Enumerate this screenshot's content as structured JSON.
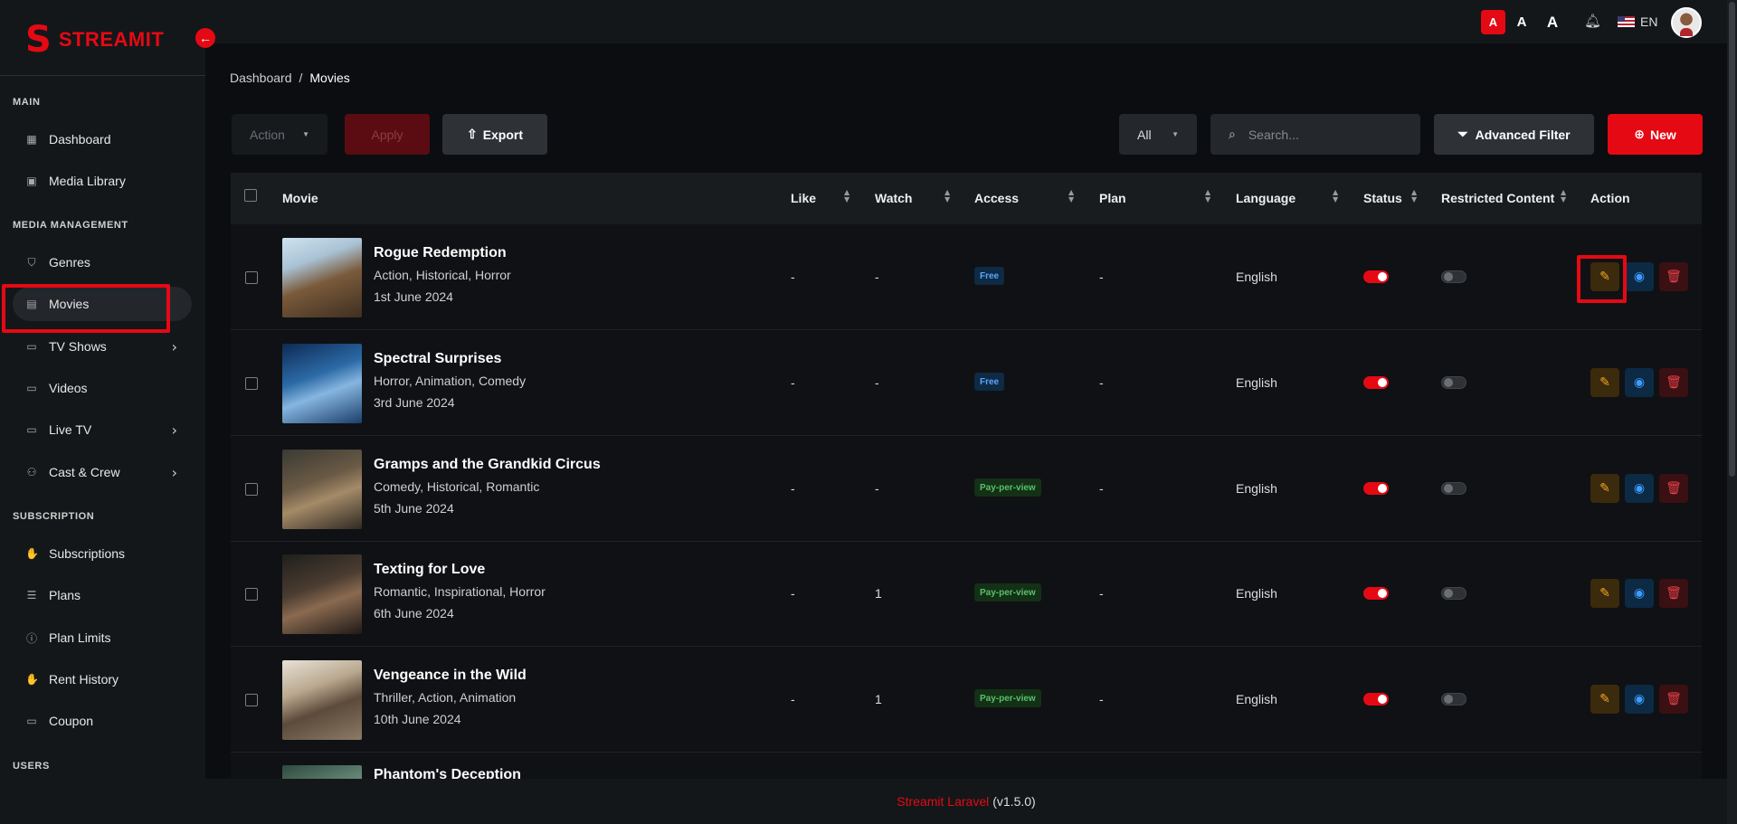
{
  "app": {
    "logo_glyph": "S",
    "logo_text": "STREAMIT",
    "accent": "#e50914"
  },
  "sidebar": {
    "sections": [
      {
        "label": "MAIN"
      },
      {
        "label": "MEDIA MANAGEMENT"
      },
      {
        "label": "SUBSCRIPTION"
      },
      {
        "label": "USERS"
      }
    ],
    "items": [
      {
        "label": "Dashboard",
        "icon": "grid-icon"
      },
      {
        "label": "Media Library",
        "icon": "image-icon"
      },
      {
        "label": "Genres",
        "icon": "shield-icon"
      },
      {
        "label": "Movies",
        "icon": "film-icon",
        "active": true
      },
      {
        "label": "TV Shows",
        "icon": "tv-icon",
        "has_children": true
      },
      {
        "label": "Videos",
        "icon": "video-icon"
      },
      {
        "label": "Live TV",
        "icon": "live-tv-icon",
        "has_children": true
      },
      {
        "label": "Cast & Crew",
        "icon": "users-icon",
        "has_children": true
      },
      {
        "label": "Subscriptions",
        "icon": "hand-icon"
      },
      {
        "label": "Plans",
        "icon": "list-icon"
      },
      {
        "label": "Plan Limits",
        "icon": "info-icon"
      },
      {
        "label": "Rent History",
        "icon": "hand-icon"
      },
      {
        "label": "Coupon",
        "icon": "ticket-icon"
      }
    ]
  },
  "topbar": {
    "font_sizes": [
      "A",
      "A",
      "A"
    ],
    "language": "EN"
  },
  "breadcrumb": {
    "root": "Dashboard",
    "separator": "/",
    "current": "Movies"
  },
  "toolbar": {
    "action_placeholder": "Action",
    "apply_label": "Apply",
    "export_label": "Export",
    "filter_value": "All",
    "search_placeholder": "Search...",
    "advanced_filter_label": "Advanced Filter",
    "new_label": "New"
  },
  "table": {
    "columns": [
      "Movie",
      "Like",
      "Watch",
      "Access",
      "Plan",
      "Language",
      "Status",
      "Restricted Content",
      "Action"
    ],
    "rows": [
      {
        "title": "Rogue Redemption",
        "genres": "Action, Historical, Horror",
        "date": "1st June 2024",
        "like": "-",
        "watch": "-",
        "access": "Free",
        "plan": "-",
        "language": "English",
        "status": true,
        "restricted": false
      },
      {
        "title": "Spectral Surprises",
        "genres": "Horror, Animation, Comedy",
        "date": "3rd June 2024",
        "like": "-",
        "watch": "-",
        "access": "Free",
        "plan": "-",
        "language": "English",
        "status": true,
        "restricted": false
      },
      {
        "title": "Gramps and the Grandkid Circus",
        "genres": "Comedy, Historical, Romantic",
        "date": "5th June 2024",
        "like": "-",
        "watch": "-",
        "access": "Pay-per-view",
        "plan": "-",
        "language": "English",
        "status": true,
        "restricted": false
      },
      {
        "title": "Texting for Love",
        "genres": "Romantic, Inspirational, Horror",
        "date": "6th June 2024",
        "like": "-",
        "watch": "1",
        "access": "Pay-per-view",
        "plan": "-",
        "language": "English",
        "status": true,
        "restricted": false
      },
      {
        "title": "Vengeance in the Wild",
        "genres": "Thriller, Action, Animation",
        "date": "10th June 2024",
        "like": "-",
        "watch": "1",
        "access": "Pay-per-view",
        "plan": "-",
        "language": "English",
        "status": true,
        "restricted": false
      },
      {
        "title": "Phantom's Deception",
        "genres": "",
        "date": "",
        "like": "",
        "watch": "",
        "access": "",
        "plan": "",
        "language": "",
        "status": null,
        "restricted": null
      }
    ]
  },
  "footer": {
    "brand": "Streamit Laravel",
    "version": "(v1.5.0)"
  }
}
